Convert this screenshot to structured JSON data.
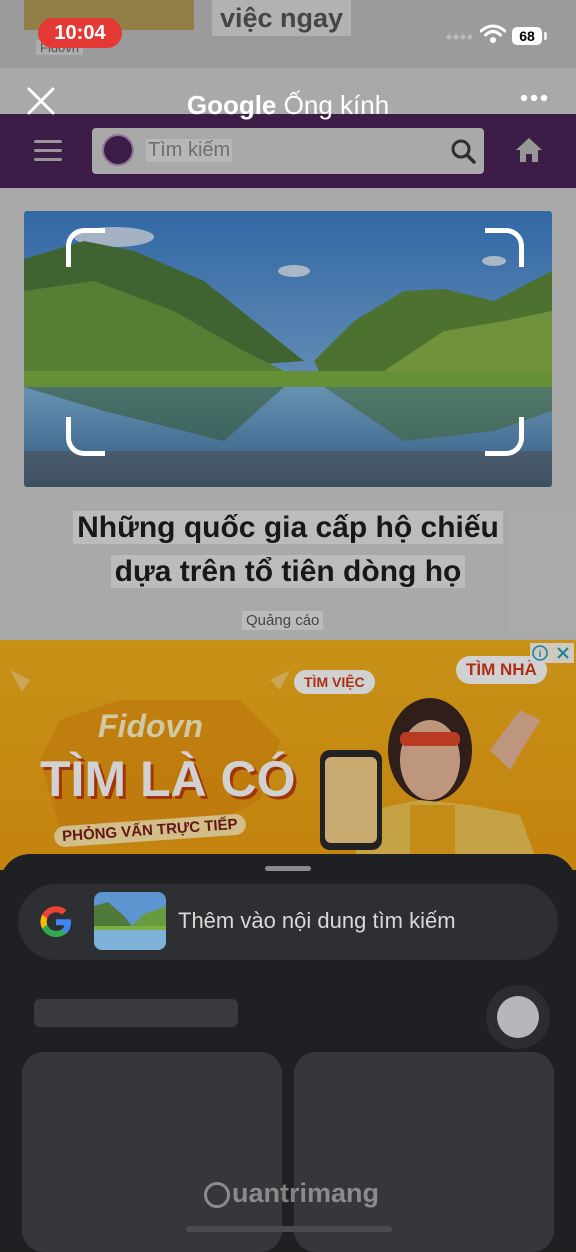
{
  "status_bar": {
    "time": "10:04",
    "battery": "68"
  },
  "lens_header": {
    "brand": "Google",
    "title": "Ống kính"
  },
  "web_page": {
    "top_ad_text": "việc ngay",
    "top_ad_brand": "Fidovn",
    "search_placeholder": "Tìm kiếm",
    "headline_line1": "Những quốc gia cấp hộ chiếu",
    "headline_line2": "dựa trên tổ tiên dòng họ",
    "ad_label": "Quảng cáo",
    "ad": {
      "brand": "Fidovn",
      "slogan": "TÌM LÀ CÓ",
      "sub": "PHỎNG VẤN TRỰC TIẾP",
      "tag1": "TÌM VIỆC",
      "tag2": "TÌM NHÀ"
    }
  },
  "bottom_sheet": {
    "add_to_search": "Thêm vào nội dung tìm kiếm"
  },
  "watermark": "uantrimang",
  "colors": {
    "nav_purple": "#4a2457",
    "ad_orange": "#f3b21c",
    "status_red": "#e53935"
  }
}
